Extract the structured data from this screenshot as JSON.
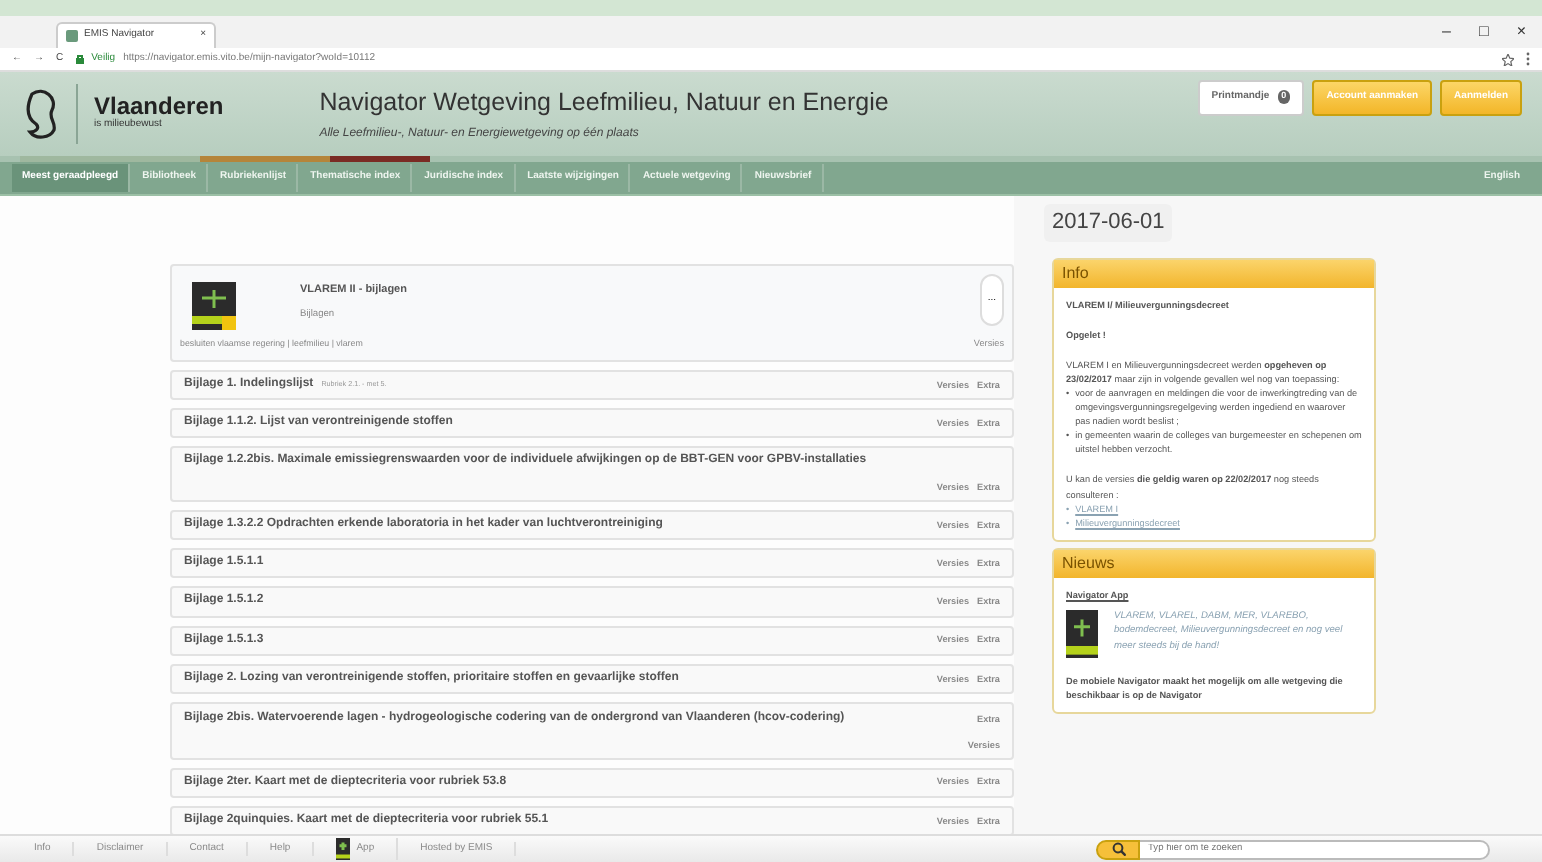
{
  "browser": {
    "tab": {
      "title": "EMIS Navigator",
      "close": "×"
    },
    "secure_label": "Veilig",
    "url": "https://navigator.emis.vito.be/mijn-navigator?woId=10112",
    "nav_buttons": [
      "←",
      "→",
      "C"
    ],
    "window_controls": [
      "–",
      "□",
      "×"
    ]
  },
  "header": {
    "brand": "Vlaanderen",
    "tagline": "is milieubewust",
    "title": "Navigator Wetgeving Leefmilieu, Natuur en Energie",
    "subtitle": "Alle Leefmilieu-, Natuur- en Energiewetgeving op één plaats",
    "buttons": [
      {
        "label": "Printmandje",
        "badge": "0",
        "kind": "plain"
      },
      {
        "label": "Account aanmaken",
        "kind": "accent"
      },
      {
        "label": "Aanmelden",
        "kind": "accent"
      }
    ]
  },
  "nav": {
    "items": [
      {
        "label": "Meest geraadpleegd",
        "selected": true
      },
      {
        "label": "Bibliotheek",
        "selected": false
      },
      {
        "label": "Rubriekenlijst",
        "selected": false
      },
      {
        "label": "Thematische index",
        "selected": false
      },
      {
        "label": "Juridische index",
        "selected": false
      },
      {
        "label": "Laatste wijzigingen",
        "selected": false
      },
      {
        "label": "Actuele wetgeving",
        "selected": false
      },
      {
        "label": "Nieuwsbrief",
        "selected": false
      }
    ],
    "language": "English"
  },
  "document": {
    "title": "VLAREM II - bijlagen",
    "subtitle": "Bijlagen",
    "menu": "...",
    "tags": "besluiten vlaamse regering | leefmilieu | vlarem",
    "versions": "Versies"
  },
  "items": [
    {
      "title": "Bijlage 1. Indelingslijst",
      "note": "Rubriek 2.1. - met 5.",
      "links": [
        "Versies",
        "Extra"
      ],
      "kind": "inline"
    },
    {
      "title": "Bijlage 1.1.2. Lijst van verontreinigende stoffen",
      "links": [
        "Versies",
        "Extra"
      ],
      "kind": "inline"
    },
    {
      "title": "Bijlage 1.2.2bis. Maximale emissiegrenswaarden voor de individuele afwijkingen op de BBT-GEN voor GPBV-installaties",
      "links": [
        "Versies",
        "Extra"
      ],
      "kind": "below"
    },
    {
      "title": "Bijlage 1.3.2.2 Opdrachten erkende laboratoria in het kader van luchtverontreiniging",
      "links": [
        "Versies",
        "Extra"
      ],
      "kind": "inline"
    },
    {
      "title": "Bijlage 1.5.1.1",
      "links": [
        "Versies",
        "Extra"
      ],
      "kind": "inline"
    },
    {
      "title": "Bijlage 1.5.1.2",
      "links": [
        "Versies",
        "Extra"
      ],
      "kind": "inline"
    },
    {
      "title": "Bijlage 1.5.1.3",
      "links": [
        "Versies",
        "Extra"
      ],
      "kind": "inline"
    },
    {
      "title": "Bijlage 2. Lozing van verontreinigende stoffen, prioritaire stoffen en gevaarlijke stoffen",
      "links": [
        "Versies",
        "Extra"
      ],
      "kind": "inline"
    },
    {
      "title": "Bijlage 2bis. Watervoerende lagen - hydrogeologische codering van de ondergrond van Vlaanderen (hcov-codering)",
      "links": [
        "Extra",
        "Versies"
      ],
      "kind": "split"
    },
    {
      "title": "Bijlage 2ter. Kaart met de dieptecriteria voor rubriek 53.8",
      "links": [
        "Versies",
        "Extra"
      ],
      "kind": "inline"
    },
    {
      "title": "Bijlage 2quinquies. Kaart met de dieptecriteria voor rubriek 55.1",
      "links": [
        "Versies",
        "Extra"
      ],
      "kind": "inline"
    }
  ],
  "date": "2017-06-01",
  "info": {
    "title": "Info",
    "heading": "VLAREM I/ Milieuvergunningsdecreet",
    "warning": "Opgelet !",
    "text": "VLAREM I en Milieuvergunningsdecreet werden **opgeheven op 23/02/2017** maar zijn in volgende gevallen wel nog van toepassing:",
    "marker": "•",
    "bullets": [
      "voor de aanvragen en meldingen die voor de inwerkingtreding van de omgevingsvergunningsregelgeving werden ingediend en waarover pas nadien wordt beslist ;",
      "in gemeenten waarin de colleges van burgemeester en schepenen om uitstel hebben verzocht."
    ],
    "text2": "U kan de versies **die geldig waren op 22/02/2017** nog steeds consulteren :",
    "links": [
      "VLAREM I",
      "Milieuvergunningsdecreet"
    ]
  },
  "news": {
    "title": "Nieuws",
    "heading": "Navigator App",
    "teaser": "VLAREM, VLAREL, DABM, MER, VLAREBO, bodemdecreet, Milieuvergunningsdecreet en nog veel meer steeds bij de hand!",
    "text": "De mobiele Navigator maakt het mogelijk om alle wetgeving die beschikbaar is op de Navigator"
  },
  "footer": {
    "links": [
      {
        "label": "Info",
        "kind": "text"
      },
      {
        "label": "Disclaimer",
        "kind": "text"
      },
      {
        "label": "Contact",
        "kind": "text"
      },
      {
        "label": "Help",
        "kind": "text"
      },
      {
        "label": "App",
        "kind": "app"
      },
      {
        "label": "Hosted by EMIS",
        "kind": "text"
      }
    ],
    "search": {
      "placeholder": "Typ hier om te zoeken"
    }
  }
}
